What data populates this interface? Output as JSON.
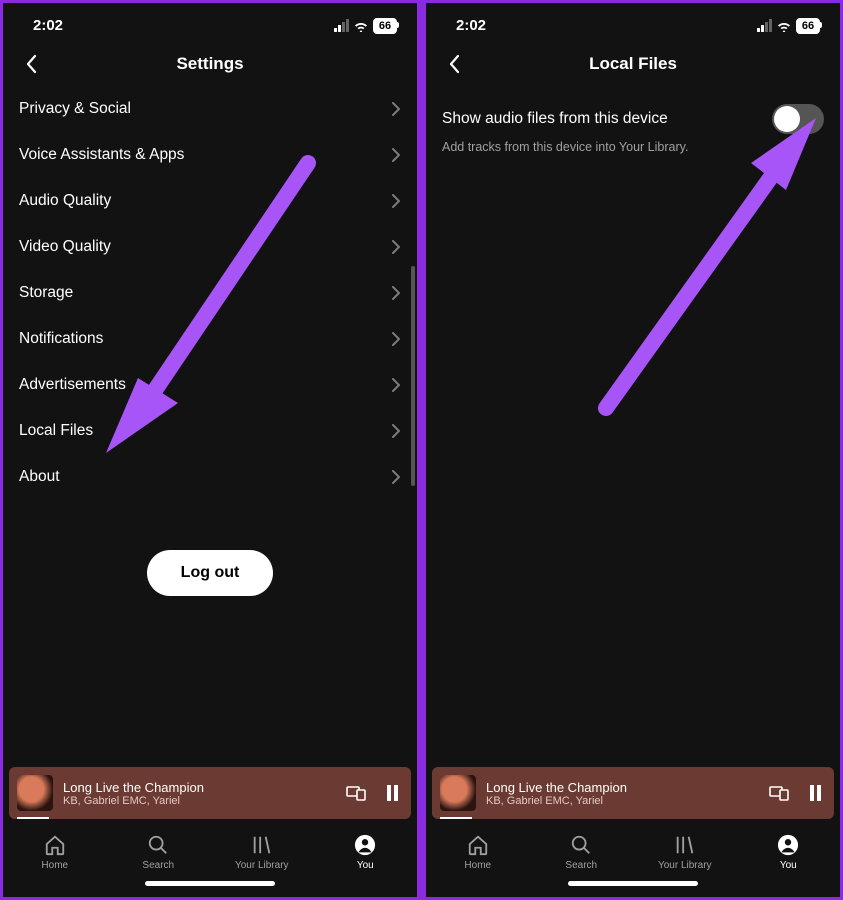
{
  "status": {
    "time": "2:02",
    "battery": "66"
  },
  "left": {
    "title": "Settings",
    "items": [
      "Privacy & Social",
      "Voice Assistants & Apps",
      "Audio Quality",
      "Video Quality",
      "Storage",
      "Notifications",
      "Advertisements",
      "Local Files",
      "About"
    ],
    "logout_label": "Log out"
  },
  "right": {
    "title": "Local Files",
    "toggle_label": "Show audio files from this device",
    "toggle_subtext": "Add tracks from this device into Your Library."
  },
  "now_playing": {
    "title": "Long Live the Champion",
    "artist": "KB, Gabriel EMC, Yariel"
  },
  "tabs": [
    {
      "label": "Home"
    },
    {
      "label": "Search"
    },
    {
      "label": "Your Library"
    },
    {
      "label": "You"
    }
  ]
}
